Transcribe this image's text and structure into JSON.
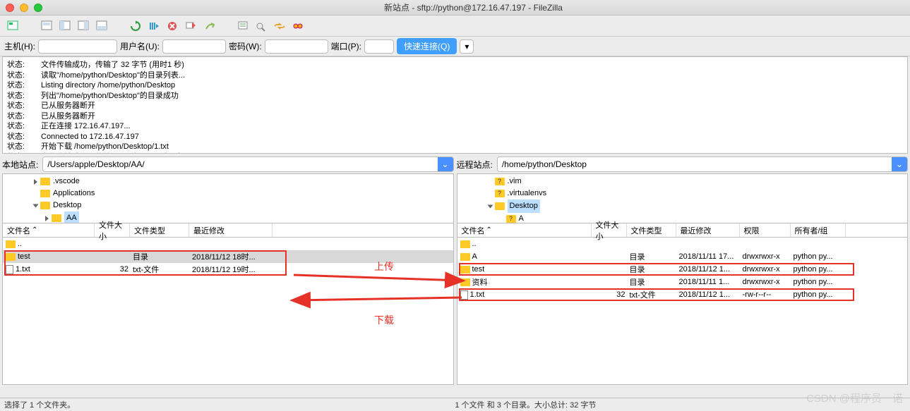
{
  "window": {
    "title": "新站点 - sftp://python@172.16.47.197 - FileZilla"
  },
  "conn": {
    "host_label": "主机(H):",
    "user_label": "用户名(U):",
    "pass_label": "密码(W):",
    "port_label": "端口(P):",
    "quick_btn": "快速连接(Q)",
    "dropdown_glyph": "▾"
  },
  "log": [
    {
      "label": "状态:",
      "msg": "文件传输成功，传输了 32 字节 (用时1 秒)"
    },
    {
      "label": "状态:",
      "msg": "读取\"/home/python/Desktop\"的目录列表..."
    },
    {
      "label": "状态:",
      "msg": "Listing directory /home/python/Desktop"
    },
    {
      "label": "状态:",
      "msg": "列出\"/home/python/Desktop\"的目录成功"
    },
    {
      "label": "状态:",
      "msg": "已从服务器断开"
    },
    {
      "label": "状态:",
      "msg": "已从服务器断开"
    },
    {
      "label": "状态:",
      "msg": "正在连接 172.16.47.197..."
    },
    {
      "label": "状态:",
      "msg": "Connected to 172.16.47.197"
    },
    {
      "label": "状态:",
      "msg": "开始下载 /home/python/Desktop/1.txt"
    },
    {
      "label": "状态:",
      "msg": "文件传输成功，传输了 32 字节 (用时1 秒)"
    }
  ],
  "local": {
    "label": "本地站点:",
    "path": "/Users/apple/Desktop/AA/",
    "tree": [
      {
        "name": ".vscode",
        "icon": "folder",
        "indent": 1,
        "arrow": "right"
      },
      {
        "name": "Applications",
        "icon": "folder",
        "indent": 1,
        "arrow": "none"
      },
      {
        "name": "Desktop",
        "icon": "folder",
        "indent": 1,
        "arrow": "down"
      },
      {
        "name": "AA",
        "icon": "folder-sel",
        "indent": 2,
        "arrow": "right"
      }
    ],
    "hdr": [
      "文件名",
      "文件大小",
      "文件类型",
      "最近修改"
    ],
    "rows": [
      {
        "name": "..",
        "size": "",
        "type": "",
        "mod": "",
        "icon": "folder"
      },
      {
        "name": "test",
        "size": "",
        "type": "目录",
        "mod": "2018/11/12 18时...",
        "icon": "folder",
        "sel": true
      },
      {
        "name": "1.txt",
        "size": "32",
        "type": "txt-文件",
        "mod": "2018/11/12 19时...",
        "icon": "file"
      }
    ],
    "status": "选择了 1 个文件夹。"
  },
  "remote": {
    "label": "远程站点:",
    "path": "/home/python/Desktop",
    "tree": [
      {
        "name": ".vim",
        "icon": "folder-q",
        "indent": 1,
        "arrow": "none"
      },
      {
        "name": ".virtualenvs",
        "icon": "folder-q",
        "indent": 1,
        "arrow": "none"
      },
      {
        "name": "Desktop",
        "icon": "folder-sel",
        "indent": 1,
        "arrow": "down"
      },
      {
        "name": "A",
        "icon": "folder-q",
        "indent": 2,
        "arrow": "none"
      }
    ],
    "hdr": [
      "文件名",
      "文件大小",
      "文件类型",
      "最近修改",
      "权限",
      "所有者/组"
    ],
    "rows": [
      {
        "name": "..",
        "size": "",
        "type": "",
        "mod": "",
        "perm": "",
        "own": "",
        "icon": "folder"
      },
      {
        "name": "A",
        "size": "",
        "type": "目录",
        "mod": "2018/11/11 17...",
        "perm": "drwxrwxr-x",
        "own": "python py...",
        "icon": "folder"
      },
      {
        "name": "test",
        "size": "",
        "type": "目录",
        "mod": "2018/11/12 1...",
        "perm": "drwxrwxr-x",
        "own": "python py...",
        "icon": "folder"
      },
      {
        "name": "资料",
        "size": "",
        "type": "目录",
        "mod": "2018/11/11 1...",
        "perm": "drwxrwxr-x",
        "own": "python py...",
        "icon": "folder"
      },
      {
        "name": "1.txt",
        "size": "32",
        "type": "txt-文件",
        "mod": "2018/11/12 1...",
        "perm": "-rw-r--r--",
        "own": "python py...",
        "icon": "file"
      }
    ],
    "status": "1 个文件 和 3 个目录。大小总计: 32 字节"
  },
  "annot": {
    "upload": "上传",
    "download": "下载"
  },
  "watermark": "CSDN @程序员一诺"
}
